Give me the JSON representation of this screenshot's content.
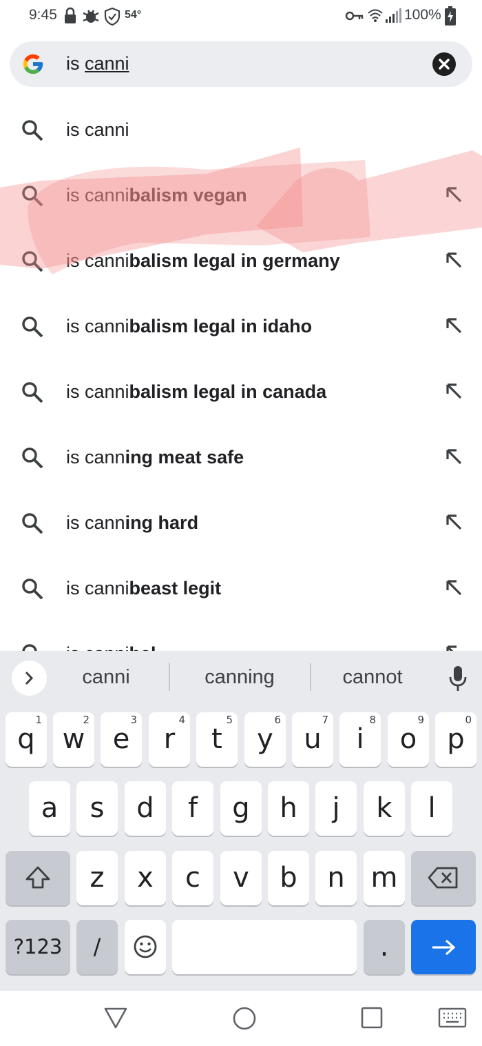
{
  "status_bar": {
    "time": "9:45",
    "temperature": "54°",
    "battery": "100%",
    "icons": [
      "lock-icon",
      "bug-icon",
      "shield-icon",
      "key-icon",
      "wifi-icon",
      "signal-icon",
      "battery-charging-icon"
    ]
  },
  "search": {
    "prefix": "is ",
    "query_underlined": "canni",
    "logo_icon": "google-g-icon",
    "clear_icon": "close-icon"
  },
  "suggestions": [
    {
      "typed": "is canni",
      "completion": ""
    },
    {
      "typed": "is canni",
      "completion": "balism vegan"
    },
    {
      "typed": "is canni",
      "completion": "balism legal in germany"
    },
    {
      "typed": "is canni",
      "completion": "balism legal in idaho"
    },
    {
      "typed": "is canni",
      "completion": "balism legal in canada"
    },
    {
      "typed": "is cann",
      "completion": "ing meat safe"
    },
    {
      "typed": "is cann",
      "completion": "ing hard"
    },
    {
      "typed": "is canni",
      "completion": "beast legit"
    },
    {
      "typed": "is canni",
      "completion": "bal ..."
    }
  ],
  "keyboard": {
    "suggestions": [
      "canni",
      "canning",
      "cannot"
    ],
    "row1": [
      {
        "k": "q",
        "n": "1"
      },
      {
        "k": "w",
        "n": "2"
      },
      {
        "k": "e",
        "n": "3"
      },
      {
        "k": "r",
        "n": "4"
      },
      {
        "k": "t",
        "n": "5"
      },
      {
        "k": "y",
        "n": "6"
      },
      {
        "k": "u",
        "n": "7"
      },
      {
        "k": "i",
        "n": "8"
      },
      {
        "k": "o",
        "n": "9"
      },
      {
        "k": "p",
        "n": "0"
      }
    ],
    "row2": [
      "a",
      "s",
      "d",
      "f",
      "g",
      "h",
      "j",
      "k",
      "l"
    ],
    "row3": [
      "z",
      "x",
      "c",
      "v",
      "b",
      "n",
      "m"
    ],
    "symbols_label": "?123",
    "slash_label": "/",
    "period_label": ".",
    "colors": {
      "accent": "#1a73e8",
      "key": "#ffffff",
      "dark_key": "#c7cad0",
      "background": "#e8eaed"
    }
  },
  "nav_bar": {
    "icons": [
      "back-icon",
      "home-icon",
      "recents-icon",
      "keyboard-icon"
    ]
  }
}
